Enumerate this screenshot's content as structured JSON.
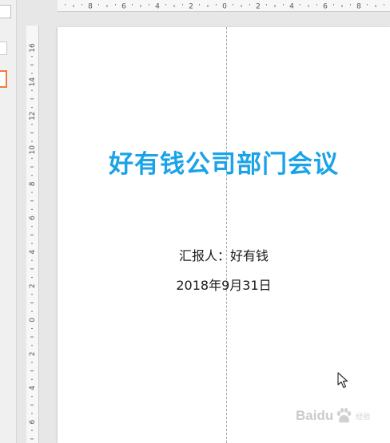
{
  "slide": {
    "title": "好有钱公司部门会议",
    "reporter": "汇报人：好有钱",
    "date": "2018年9月31日"
  },
  "ruler_top": {
    "labels": [
      "8",
      "6",
      "4",
      "2",
      "0",
      "2",
      "4",
      "6",
      "8"
    ]
  },
  "ruler_left": {
    "labels": [
      "16",
      "14",
      "12",
      "10",
      "8",
      "6",
      "4",
      "2",
      "0",
      "2",
      "4",
      "6"
    ]
  },
  "watermark": {
    "brand": "Baidu",
    "sub": "经验"
  },
  "colors": {
    "title": "#1aa3e8",
    "accent_thumb": "#f07c3e"
  },
  "icons": {
    "cursor": "mouse-pointer-icon",
    "watermark": "baidu-paw-icon"
  }
}
